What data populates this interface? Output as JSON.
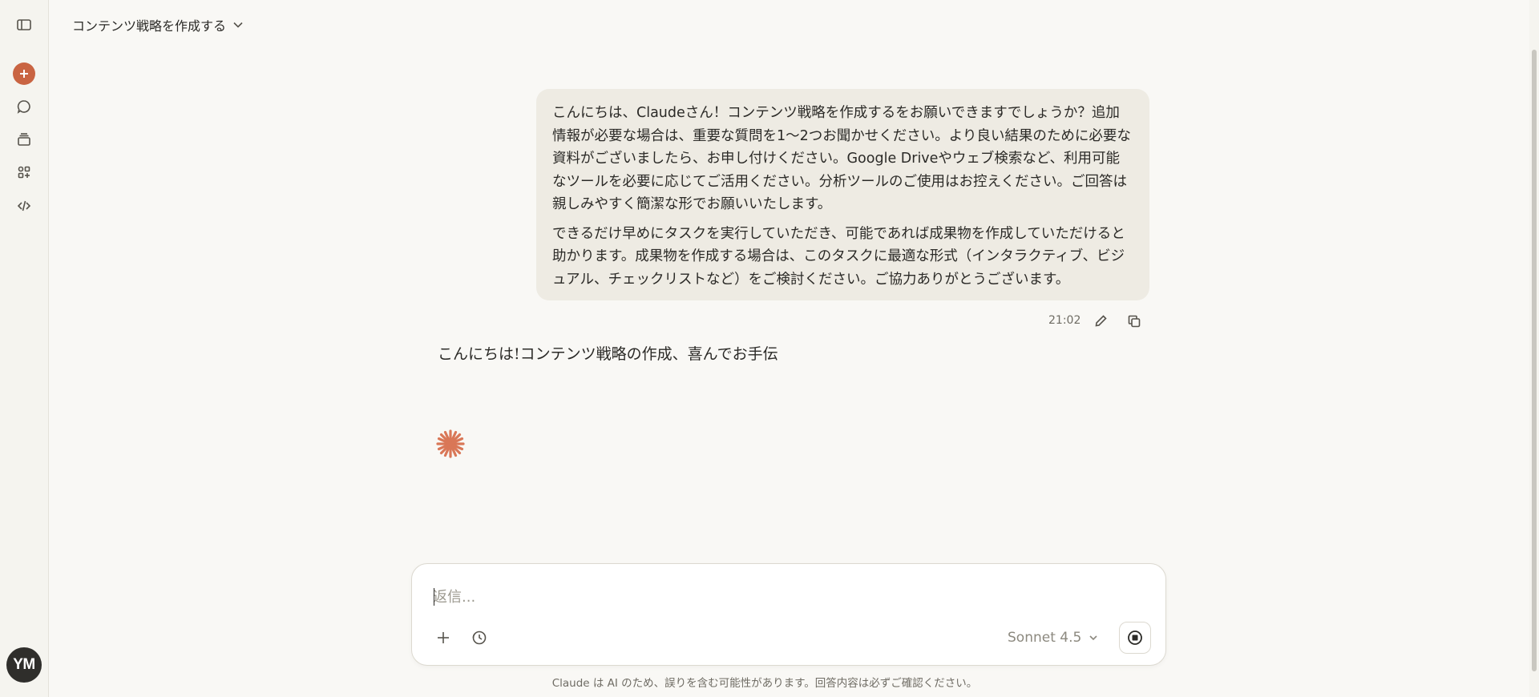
{
  "header": {
    "title": "コンテンツ戦略を作成する"
  },
  "sidebar": {
    "items": [
      {
        "name": "sidebar-toggle",
        "icon": "panel-icon"
      },
      {
        "name": "new-chat",
        "icon": "plus-icon",
        "color": "#c96442"
      },
      {
        "name": "chats",
        "icon": "chat-bubble-icon"
      },
      {
        "name": "projects",
        "icon": "archive-icon"
      },
      {
        "name": "artifacts",
        "icon": "shapes-icon"
      },
      {
        "name": "code",
        "icon": "code-icon"
      }
    ],
    "avatar_initials": "YM"
  },
  "messages": {
    "user": {
      "paragraph1": "こんにちは、Claudeさん！コンテンツ戦略を作成するをお願いできますでしょうか？追加情報が必要な場合は、重要な質問を1〜2つお聞かせください。より良い結果のために必要な資料がございましたら、お申し付けください。Google Driveやウェブ検索など、利用可能なツールを必要に応じてご活用ください。分析ツールのご使用はお控えください。ご回答は親しみやすく簡潔な形でお願いいたします。",
      "paragraph2": "できるだけ早めにタスクを実行していただき、可能であれば成果物を作成していただけると助かります。成果物を作成する場合は、このタスクに最適な形式（インタラクティブ、ビジュアル、チェックリストなど）をご検討ください。ご協力ありがとうございます。",
      "timestamp": "21:02"
    },
    "assistant": {
      "text": "こんにちは!コンテンツ戦略の作成、喜んでお手伝"
    }
  },
  "composer": {
    "placeholder": "返信...",
    "value": "",
    "model": "Sonnet 4.5"
  },
  "footer": {
    "disclaimer": "Claude は AI のため、誤りを含む可能性があります。回答内容は必ずご確認ください。"
  },
  "colors": {
    "accent": "#c96442",
    "background": "#f9f8f5",
    "user_bubble": "#eeebe3"
  }
}
